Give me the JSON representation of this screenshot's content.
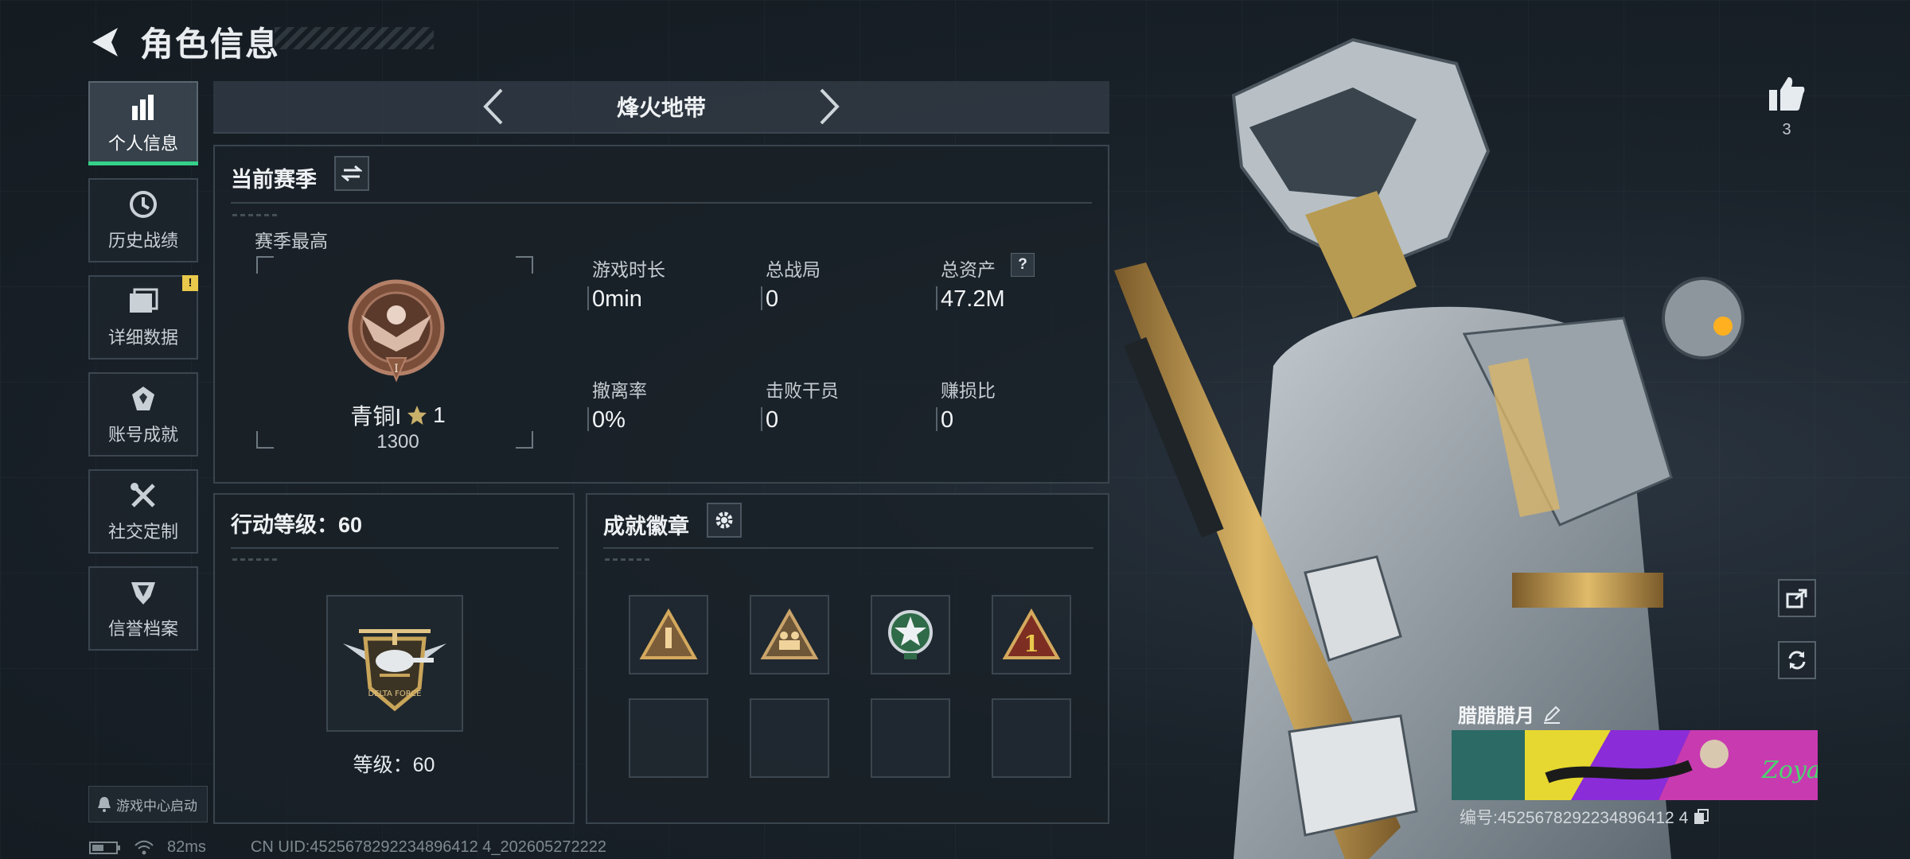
{
  "header": {
    "title": "角色信息"
  },
  "nav": {
    "items": [
      {
        "label": "个人信息",
        "icon": "bar-chart-icon",
        "active": true
      },
      {
        "label": "历史战绩",
        "icon": "history-icon"
      },
      {
        "label": "详细数据",
        "icon": "folder-icon",
        "badge": "!"
      },
      {
        "label": "账号成就",
        "icon": "achievement-icon"
      },
      {
        "label": "社交定制",
        "icon": "tools-icon"
      },
      {
        "label": "信誉档案",
        "icon": "shield-icon"
      }
    ],
    "game_center": "游戏中心启动"
  },
  "mode": {
    "name": "烽火地带"
  },
  "season": {
    "title": "当前赛季",
    "best_label": "赛季最高",
    "rank_name": "青铜I",
    "rank_stars": "1",
    "rank_points": "1300",
    "stats": [
      {
        "label": "游戏时长",
        "value": "0min"
      },
      {
        "label": "总战局",
        "value": "0"
      },
      {
        "label": "总资产",
        "value": "47.2M",
        "help": "?"
      },
      {
        "label": "撤离率",
        "value": "0%"
      },
      {
        "label": "击败干员",
        "value": "0"
      },
      {
        "label": "赚损比",
        "value": "0"
      }
    ]
  },
  "action_level": {
    "title": "行动等级：60",
    "level_text": "等级：60"
  },
  "badges": {
    "title": "成就徽章"
  },
  "profile": {
    "likes": "3",
    "name": "腊腊腊月",
    "id_text": "编号:4525678292234896412 4"
  },
  "footer": {
    "ping": "82ms",
    "uid": "CN UID:4525678292234896412 4_202605272222"
  },
  "colors": {
    "accent": "#35d18a",
    "badge": "#e9c94b",
    "bronze": "#8b5a40"
  }
}
